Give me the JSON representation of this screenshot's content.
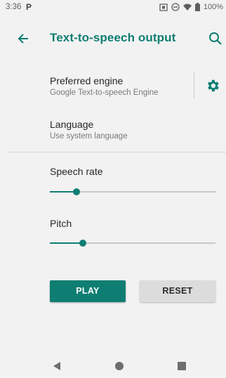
{
  "status_bar": {
    "time": "3:36",
    "notification_icon": "P",
    "battery": "100%",
    "icons": [
      "screenshot-icon",
      "do-not-disturb-icon",
      "wifi-icon",
      "battery-icon"
    ]
  },
  "app_bar": {
    "title": "Text-to-speech output",
    "back_icon": "arrow-left-icon",
    "search_icon": "search-icon"
  },
  "preferences": {
    "engine": {
      "title": "Preferred engine",
      "summary": "Google Text-to-speech Engine",
      "settings_icon": "gear-icon"
    },
    "language": {
      "title": "Language",
      "summary": "Use system language"
    },
    "speech_rate": {
      "label": "Speech rate",
      "value_fraction": 0.16
    },
    "pitch": {
      "label": "Pitch",
      "value_fraction": 0.2
    }
  },
  "buttons": {
    "play": "PLAY",
    "reset": "RESET"
  },
  "colors": {
    "accent": "#0f7e72",
    "background": "#f2f2f2"
  }
}
